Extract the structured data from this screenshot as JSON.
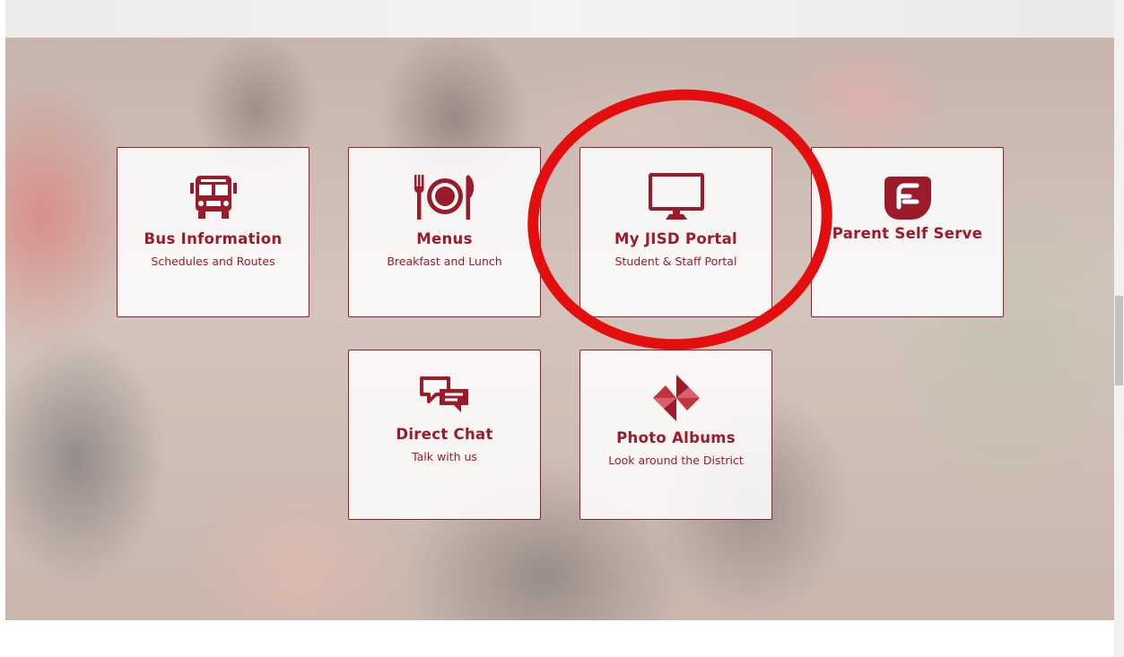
{
  "tiles": {
    "bus": {
      "title": "Bus Information",
      "subtitle": "Schedules and Routes",
      "icon": "bus-icon"
    },
    "menus": {
      "title": "Menus",
      "subtitle": "Breakfast and Lunch",
      "icon": "plate-fork-knife-icon"
    },
    "portal": {
      "title": "My JISD Portal",
      "subtitle": "Student & Staff Portal",
      "icon": "monitor-icon"
    },
    "pss": {
      "title": "Parent Self Serve",
      "subtitle": "",
      "icon": "frontline-logo-icon"
    },
    "chat": {
      "title": "Direct Chat",
      "subtitle": "Talk with us",
      "icon": "chat-bubbles-icon"
    },
    "photos": {
      "title": "Photo Albums",
      "subtitle": "Look around the District",
      "icon": "pinwheel-icon"
    }
  },
  "colors": {
    "accent": "#9b1b2a",
    "annotation": "#e50e0e"
  },
  "annotation": {
    "shape": "circle",
    "target": "My JISD Portal"
  }
}
